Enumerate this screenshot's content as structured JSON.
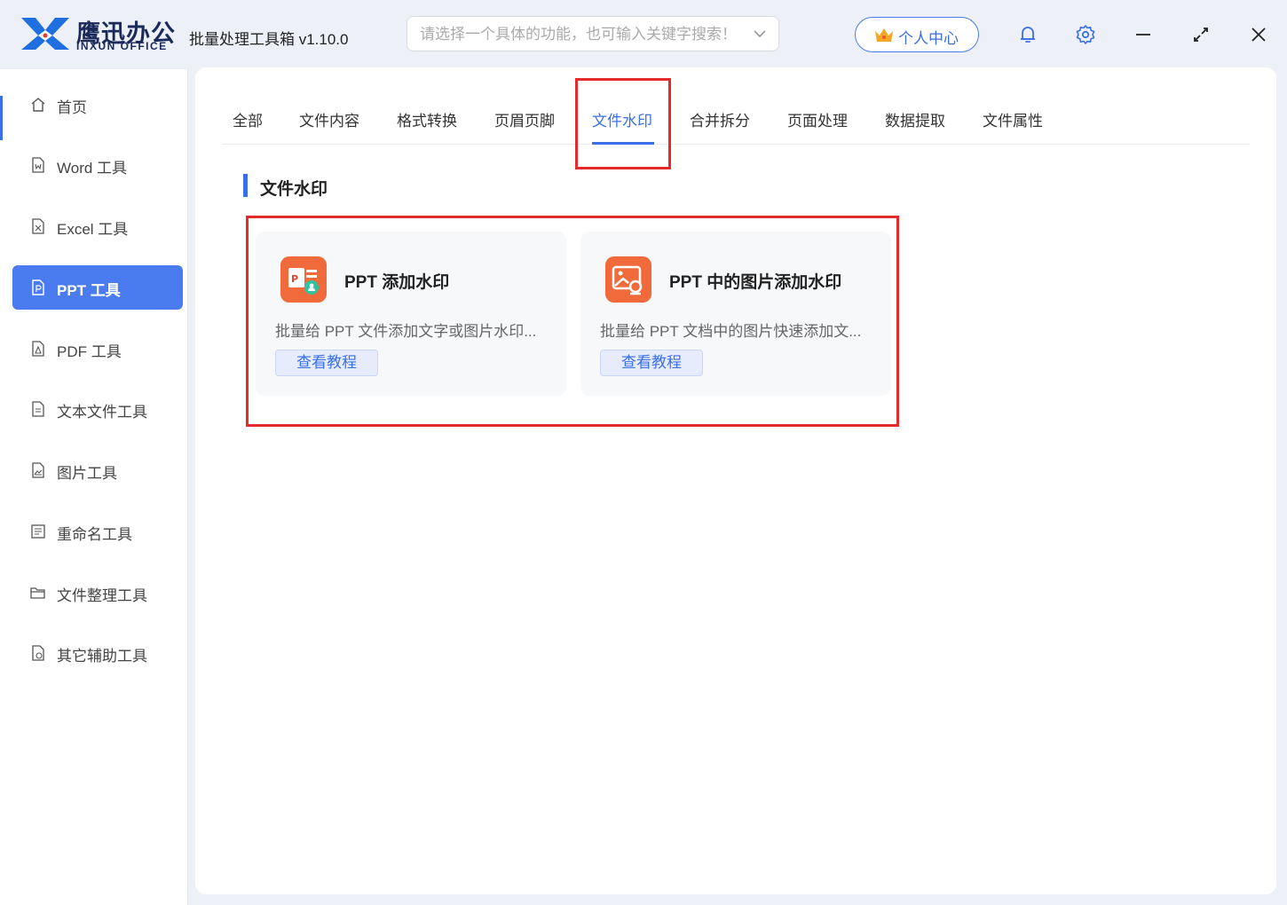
{
  "brand": {
    "name_cn": "鹰迅办公",
    "name_en": "INXUN OFFICE"
  },
  "app_title": "批量处理工具箱 v1.10.0",
  "search": {
    "placeholder": "请选择一个具体的功能，也可输入关键字搜索！"
  },
  "user_center": {
    "label": "个人中心"
  },
  "sidebar": {
    "items": [
      {
        "label": "首页",
        "icon": "home-icon"
      },
      {
        "label": "Word 工具",
        "icon": "word-file-icon"
      },
      {
        "label": "Excel 工具",
        "icon": "excel-file-icon"
      },
      {
        "label": "PPT 工具",
        "icon": "ppt-file-icon",
        "active": true
      },
      {
        "label": "PDF 工具",
        "icon": "pdf-file-icon"
      },
      {
        "label": "文本文件工具",
        "icon": "text-file-icon"
      },
      {
        "label": "图片工具",
        "icon": "image-file-icon"
      },
      {
        "label": "重命名工具",
        "icon": "rename-icon"
      },
      {
        "label": "文件整理工具",
        "icon": "folder-icon"
      },
      {
        "label": "其它辅助工具",
        "icon": "misc-tools-icon"
      }
    ]
  },
  "tabs": [
    "全部",
    "文件内容",
    "格式转换",
    "页眉页脚",
    "文件水印",
    "合并拆分",
    "页面处理",
    "数据提取",
    "文件属性"
  ],
  "active_tab": "文件水印",
  "section": {
    "title": "文件水印"
  },
  "cards": [
    {
      "title": "PPT 添加水印",
      "desc": "批量给 PPT 文件添加文字或图片水印...",
      "button": "查看教程",
      "icon": "ppt-watermark-icon"
    },
    {
      "title": "PPT 中的图片添加水印",
      "desc": "批量给 PPT 文档中的图片快速添加文...",
      "button": "查看教程",
      "icon": "ppt-image-watermark-icon"
    }
  ],
  "colors": {
    "accent": "#3b6fe8",
    "card_icon": "#f06a3c",
    "highlight": "#e42b2b"
  }
}
